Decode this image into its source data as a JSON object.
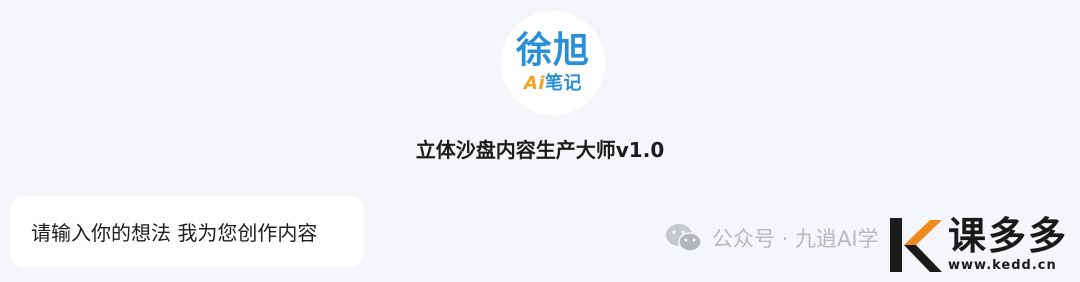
{
  "bot": {
    "avatar_line1": "徐旭",
    "avatar_ai": "Ai",
    "avatar_line2": "笔记",
    "name": "立体沙盘内容生产大师v1.0"
  },
  "chat": {
    "greeting": "请输入你的想法 我为您创作内容"
  },
  "watermark": {
    "wechat_text": "公众号 · 九逍AI学",
    "wechat_icon": "wechat-icon",
    "site_name": "课多多",
    "site_url": "www.kedd.cn",
    "site_icon": "k-logo-icon"
  },
  "colors": {
    "background": "#f4f6fa",
    "logo_blue": "#2a8fd8",
    "logo_orange": "#f3a321",
    "k_orange": "#f08a1c"
  }
}
